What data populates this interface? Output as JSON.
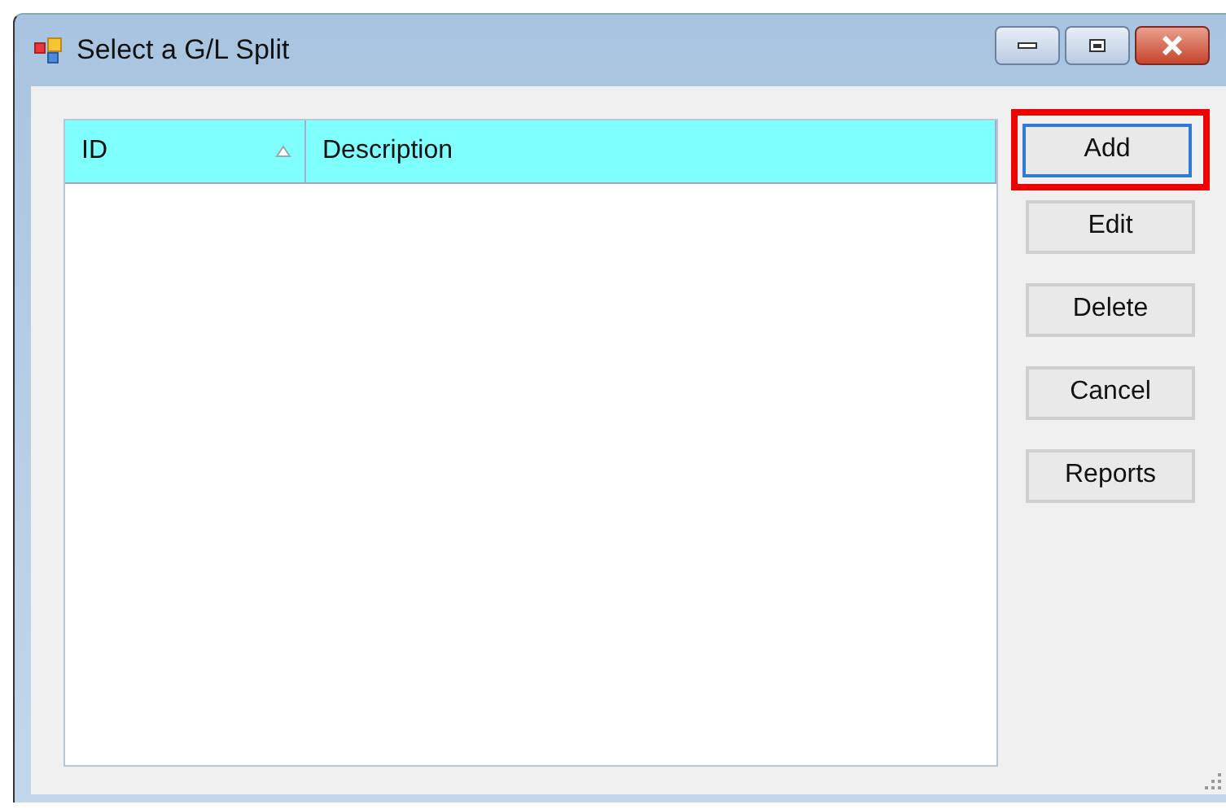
{
  "window": {
    "title": "Select a G/L Split"
  },
  "table": {
    "columns": [
      {
        "label": "ID",
        "sorted": true
      },
      {
        "label": "Description",
        "sorted": false
      }
    ]
  },
  "buttons": [
    {
      "label": "Add",
      "focused": true,
      "highlighted": true
    },
    {
      "label": "Edit",
      "focused": false,
      "highlighted": false
    },
    {
      "label": "Delete",
      "focused": false,
      "highlighted": false
    },
    {
      "label": "Cancel",
      "focused": false,
      "highlighted": false
    },
    {
      "label": "Reports",
      "focused": false,
      "highlighted": false
    }
  ]
}
